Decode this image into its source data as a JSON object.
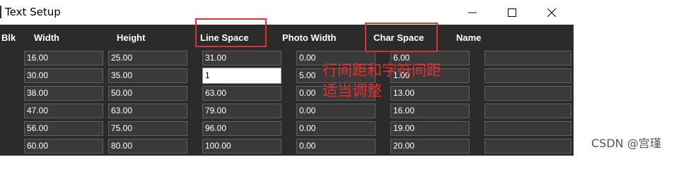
{
  "window": {
    "title": "Text Setup"
  },
  "columns": {
    "blk": "Blk",
    "width": "Width",
    "height": "Height",
    "line_space": "Line Space",
    "photo_width": "Photo Width",
    "char_space": "Char Space",
    "name": "Name"
  },
  "rows": [
    {
      "width": "16.00",
      "height": "25.00",
      "line_space": "31.00",
      "photo_width": "0.00",
      "char_space": "6.00",
      "name": ""
    },
    {
      "width": "30.00",
      "height": "35.00",
      "line_space": "1",
      "photo_width": "5.00",
      "char_space": "1.00",
      "name": ""
    },
    {
      "width": "38.00",
      "height": "50.00",
      "line_space": "63.00",
      "photo_width": "0.00",
      "char_space": "13.00",
      "name": ""
    },
    {
      "width": "47.00",
      "height": "63.00",
      "line_space": "79.00",
      "photo_width": "0.00",
      "char_space": "16.00",
      "name": ""
    },
    {
      "width": "56.00",
      "height": "75.00",
      "line_space": "96.00",
      "photo_width": "0.00",
      "char_space": "19.00",
      "name": ""
    },
    {
      "width": "60.00",
      "height": "80.00",
      "line_space": "100.00",
      "photo_width": "0.00",
      "char_space": "20.00",
      "name": ""
    }
  ],
  "annotation": {
    "line1": "行间距和字符间距",
    "line2": "适当调整"
  },
  "watermark": "CSDN @宫瑾",
  "colors": {
    "window_bg": "#2b2b2b",
    "field_bg": "#3a3a3a",
    "field_border": "#606060",
    "highlight_red": "#e03030"
  },
  "icons": {
    "minimize": "minimize-icon",
    "maximize": "maximize-icon",
    "close": "close-icon"
  }
}
